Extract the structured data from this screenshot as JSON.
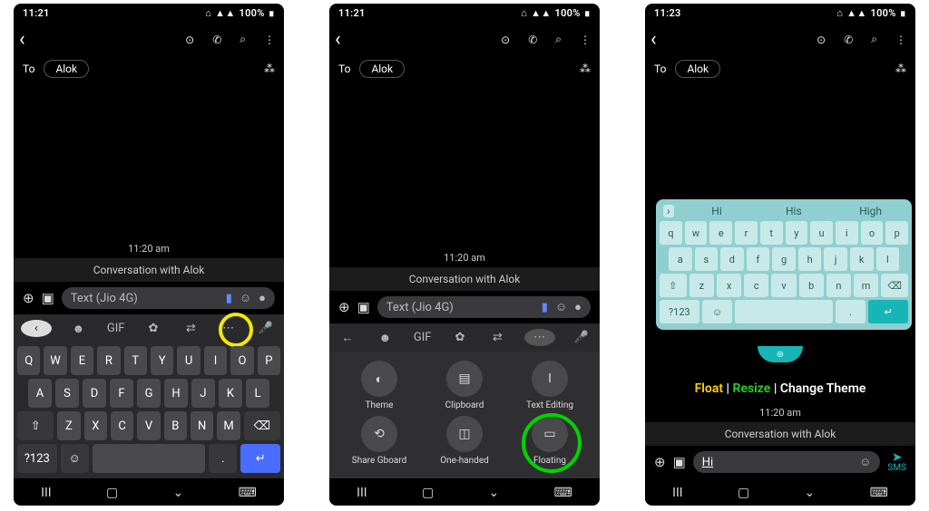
{
  "status": {
    "time1": "11:21",
    "time2": "11:21",
    "time3": "11:23",
    "battery": "100%",
    "signal": "▲▲"
  },
  "header": {
    "back": "‹"
  },
  "to": {
    "label": "To",
    "contact": "Alok"
  },
  "chat": {
    "time": "11:20 am",
    "conv": "Conversation with Alok"
  },
  "composer": {
    "placeholder": "Text (Jio 4G)",
    "typed": "Hi"
  },
  "kb": {
    "row1": [
      "Q",
      "W",
      "E",
      "R",
      "T",
      "Y",
      "U",
      "I",
      "O",
      "P"
    ],
    "row2": [
      "A",
      "S",
      "D",
      "F",
      "G",
      "H",
      "J",
      "K",
      "L"
    ],
    "row3": [
      "Z",
      "X",
      "C",
      "V",
      "B",
      "N",
      "M"
    ],
    "numkey": "?123",
    "gif": "GIF"
  },
  "options": {
    "items": [
      {
        "icon": "◐",
        "label": "Theme"
      },
      {
        "icon": "▤",
        "label": "Clipboard"
      },
      {
        "icon": "I",
        "label": "Text Editing"
      },
      {
        "icon": "⟲",
        "label": "Share Gboard"
      },
      {
        "icon": "◫",
        "label": "One-handed"
      },
      {
        "icon": "▭",
        "label": "Floating"
      }
    ]
  },
  "suggestions": [
    "Hi",
    "His",
    "High"
  ],
  "fk": {
    "row1": [
      "q",
      "w",
      "e",
      "r",
      "t",
      "y",
      "u",
      "i",
      "o",
      "p"
    ],
    "row2": [
      "a",
      "s",
      "d",
      "f",
      "g",
      "h",
      "j",
      "k",
      "l"
    ],
    "row3": [
      "z",
      "x",
      "c",
      "v",
      "b",
      "n",
      "m"
    ],
    "numkey": "?123"
  },
  "caption": {
    "float": "Float",
    "resize": "Resize",
    "change": "Change  Theme"
  },
  "sms": "SMS"
}
